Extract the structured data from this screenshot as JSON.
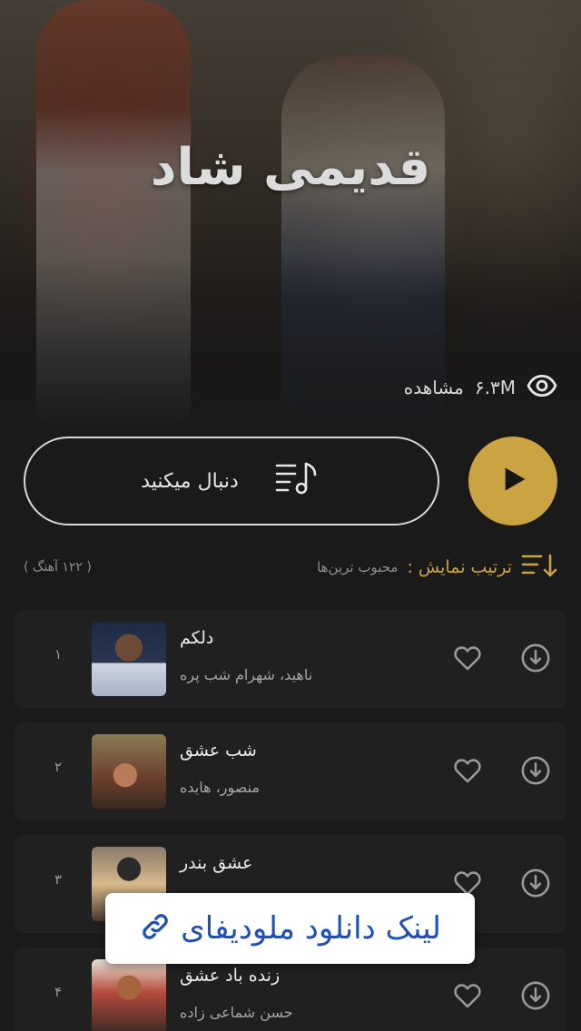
{
  "playlist": {
    "title": "قدیمی شاد",
    "views_count": "۶.۳M",
    "views_label": "مشاهده"
  },
  "actions": {
    "follow_label": "دنبال میکنید"
  },
  "sort": {
    "label": "ترتیب نمایش :",
    "value": "محبوب ترین‌ها",
    "track_count": "( ۱۲۲ آهنگ )"
  },
  "tracks": [
    {
      "index": "۱",
      "title": "دلکم",
      "artist": "ناهید، شهرام شب پره"
    },
    {
      "index": "۲",
      "title": "شب عشق",
      "artist": "منصور، هایده"
    },
    {
      "index": "۳",
      "title": "عشق بندر",
      "artist": ""
    },
    {
      "index": "۴",
      "title": "زنده باد عشق",
      "artist": "حسن شماعی زاده"
    }
  ],
  "overlay": {
    "text": "لینک دانلود ملودیفای"
  },
  "colors": {
    "accent": "#c9a440",
    "background": "#1a1a1a",
    "row": "#202020",
    "link": "#1f4fb8"
  },
  "icons": {
    "views": "eye-icon",
    "play": "play-icon",
    "follow": "playlist-music-icon",
    "sort": "sort-icon",
    "like": "heart-icon",
    "download": "download-icon",
    "link": "link-icon"
  }
}
